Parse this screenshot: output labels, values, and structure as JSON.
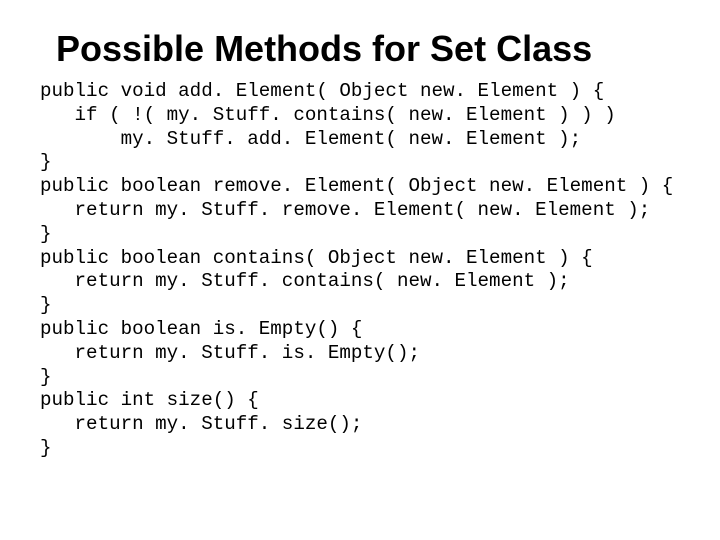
{
  "title": "Possible Methods for Set Class",
  "code": "public void add. Element( Object new. Element ) {\n   if ( !( my. Stuff. contains( new. Element ) ) )\n       my. Stuff. add. Element( new. Element );\n}\npublic boolean remove. Element( Object new. Element ) {\n   return my. Stuff. remove. Element( new. Element );\n}\npublic boolean contains( Object new. Element ) {\n   return my. Stuff. contains( new. Element );\n}\npublic boolean is. Empty() {\n   return my. Stuff. is. Empty();\n}\npublic int size() {\n   return my. Stuff. size();\n}"
}
